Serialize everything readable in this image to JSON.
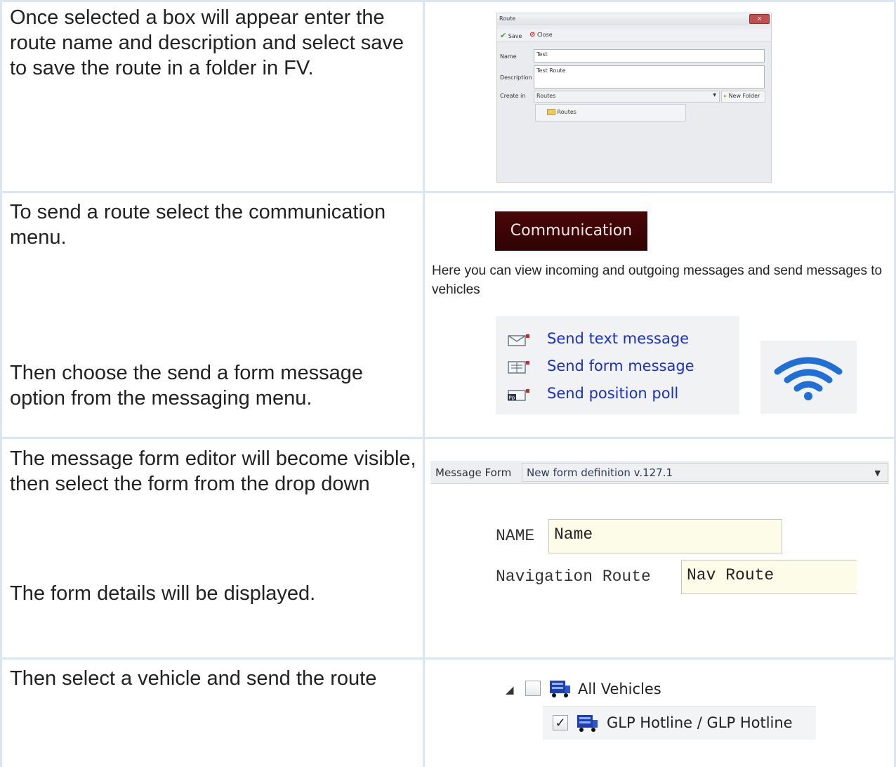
{
  "rows": [
    {
      "left_text": "Once selected a box will appear enter the route name and description and select save to save the route in a folder in FV."
    },
    {
      "left_text": "To send a route select the communication menu.",
      "left_text_2": "Then choose the send a form message option from the messaging menu."
    },
    {
      "left_text": "The message form editor will become visible, then select the form from the drop down",
      "left_text_2": "The form details will be displayed."
    },
    {
      "left_text": "Then select a vehicle and send the route"
    }
  ],
  "route_dialog": {
    "title": "Route",
    "close_x": "x",
    "save_label": "Save",
    "close_label": "Close",
    "name_label": "Name",
    "name_value": "Test",
    "description_label": "Description",
    "description_value": "Test Route",
    "create_in_label": "Create in",
    "create_in_value": "Routes",
    "new_folder_label": "New Folder",
    "tree_item": "Routes"
  },
  "communication": {
    "menu_label": "Communication",
    "description": "Here you can view incoming and outgoing messages and send messages to vehicles",
    "items": [
      "Send text message",
      "Send form message",
      "Send position poll"
    ],
    "icon_names": [
      "envelope-text-icon",
      "envelope-form-icon",
      "envelope-poll-icon",
      "wifi-icon"
    ]
  },
  "message_form": {
    "label": "Message Form",
    "selected": "New form definition v.127.1",
    "fields": [
      {
        "label": "NAME",
        "value": "Name"
      },
      {
        "label": "Navigation Route",
        "value": "Nav Route"
      }
    ]
  },
  "vehicles": {
    "all_label": "All Vehicles",
    "item_label": "GLP Hotline / GLP Hotline",
    "item_checked": "✓"
  },
  "colors": {
    "grid": "#dbe6f0",
    "link": "#1a2fd0",
    "comm_bg": "#3a0405",
    "wifi": "#1f6fd6"
  }
}
